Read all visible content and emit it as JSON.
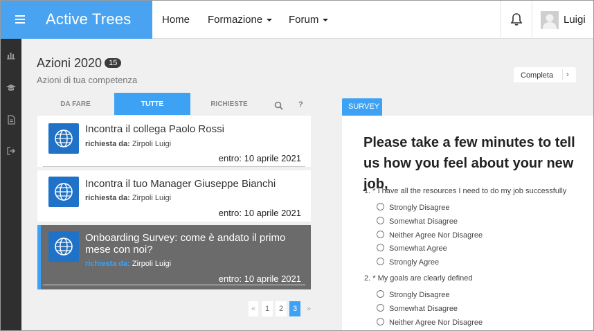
{
  "header": {
    "brand": "Active Trees",
    "nav": [
      {
        "label": "Home"
      },
      {
        "label": "Formazione"
      },
      {
        "label": "Forum"
      }
    ],
    "user_name": "Luigi"
  },
  "page": {
    "title": "Azioni 2020",
    "count": "15",
    "subtitle": "Azioni di tua competenza",
    "completa_label": "Completa"
  },
  "tabs": [
    {
      "label": "DA FARE"
    },
    {
      "label": "TUTTE"
    },
    {
      "label": "RICHIESTE"
    }
  ],
  "tab_icons": {
    "search": "search-icon",
    "help": "?"
  },
  "actions": [
    {
      "title": "Incontra il collega Paolo Rossi",
      "req_label": "richiesta da:",
      "req_name": "Zirpoli Luigi",
      "due": "entro: 10 aprile 2021",
      "selected": false
    },
    {
      "title": "Incontra il tuo Manager Giuseppe Bianchi",
      "req_label": "richiesta da:",
      "req_name": "Zirpoli Luigi",
      "due": "entro: 10 aprile 2021",
      "selected": false
    },
    {
      "title": "Onboarding Survey: come è andato il primo mese con noi?",
      "req_label": "richiesta da:",
      "req_name": "Zirpoli Luigi",
      "due": "entro: 10 aprile 2021",
      "selected": true
    }
  ],
  "pagination": {
    "prev": "«",
    "pages": [
      "1",
      "2",
      "3"
    ],
    "current": "3",
    "next": "»"
  },
  "survey": {
    "tab_label": "SURVEY",
    "heading": "Please take a few minutes to tell us how you feel about your new job,",
    "questions": [
      {
        "text": "1. * I have all the resources I need to do my job successfully",
        "options": [
          "Strongly Disagree",
          "Somewhat Disagree",
          "Neither Agree Nor Disagree",
          "Somewhat Agree",
          "Strongly Agree"
        ]
      },
      {
        "text": "2. * My goals are clearly defined",
        "options": [
          "Strongly Disagree",
          "Somewhat Disagree",
          "Neither Agree Nor Disagree"
        ]
      }
    ]
  },
  "colors": {
    "accent": "#3ea2f4",
    "brand": "#4aa3f0",
    "rail": "#2f2f2f",
    "selected_card": "#6b6b6b",
    "globe_tile": "#1f72c7"
  }
}
